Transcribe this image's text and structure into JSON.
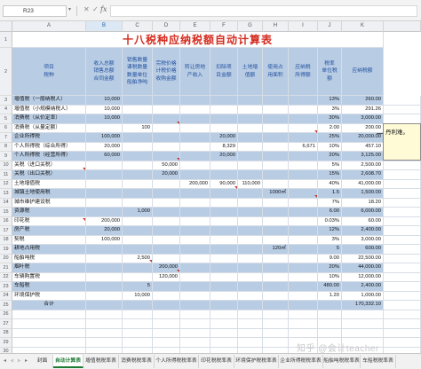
{
  "formula_bar": {
    "cell_ref": "R23",
    "fx": "fx",
    "nav_arrow": "▾",
    "cancel": "✕",
    "confirm": "✓"
  },
  "columns": [
    "A",
    "B",
    "C",
    "D",
    "E",
    "F",
    "G",
    "H",
    "I",
    "J",
    "K"
  ],
  "title": "十八税种应纳税额自动计算表",
  "headers": {
    "A": "项目\n税种",
    "B": "收入总额\n销售总额\n合同金额",
    "C": "销售数量\n课税数量\n数量单位\n船舶净吨",
    "D": "完税价格\n计税价格\n收购金额",
    "E": "转让房地\n产收入",
    "F": "扣除项\n目金额",
    "G": "土地增\n值额",
    "H": "使用占\n用面积",
    "I": "应纳税\n所得额",
    "J": "税率\n单位税额",
    "K": "应纳税额"
  },
  "rows": [
    {
      "n": "3",
      "A": "增值税（一般纳税人）",
      "B": "10,000",
      "C": "",
      "D": "",
      "E": "",
      "F": "",
      "G": "",
      "H": "",
      "I": "",
      "J": "13%",
      "K": "260.00",
      "style": "blue"
    },
    {
      "n": "4",
      "A": "增值税（小规模纳税人）",
      "B": "10,000",
      "C": "",
      "D": "",
      "E": "",
      "F": "",
      "G": "",
      "H": "",
      "I": "",
      "J": "3%",
      "K": "291.26",
      "style": "white"
    },
    {
      "n": "5",
      "A": "消费税（从价定率）",
      "B": "10,000",
      "C": "",
      "D": "",
      "E": "",
      "F": "",
      "G": "",
      "H": "",
      "I": "",
      "J": "30%",
      "K": "3,000.00",
      "style": "blue"
    },
    {
      "n": "6",
      "A": "消费税（从量定额）",
      "B": "",
      "C": "100",
      "D": "",
      "E": "",
      "F": "",
      "G": "",
      "H": "",
      "I": "",
      "J": "2.00",
      "K": "200.00",
      "style": "white"
    },
    {
      "n": "7",
      "A": "企业所得税",
      "B": "100,000",
      "C": "",
      "D": "",
      "E": "",
      "F": "20,000",
      "G": "",
      "H": "",
      "I": "",
      "J": "25%",
      "K": "20,000.00",
      "style": "blue"
    },
    {
      "n": "8",
      "A": "个人所得税（综合所得）",
      "B": "20,000",
      "C": "",
      "D": "",
      "E": "",
      "F": "8,329",
      "G": "",
      "H": "",
      "I": "6,671",
      "J": "10%",
      "K": "457.10",
      "style": "white"
    },
    {
      "n": "9",
      "A": "个人所得税（经营所得）",
      "B": "60,000",
      "C": "",
      "D": "",
      "E": "",
      "F": "20,000",
      "G": "",
      "H": "",
      "I": "",
      "J": "20%",
      "K": "3,125.00",
      "style": "blue"
    },
    {
      "n": "10",
      "A": "关税（进口关税）",
      "B": "",
      "C": "",
      "D": "50,000",
      "E": "",
      "F": "",
      "G": "",
      "H": "",
      "I": "",
      "J": "5%",
      "K": "2,500.00",
      "style": "white"
    },
    {
      "n": "11",
      "A": "关税（出口关税）",
      "B": "",
      "C": "",
      "D": "20,000",
      "E": "",
      "F": "",
      "G": "",
      "H": "",
      "I": "",
      "J": "15%",
      "K": "2,608.70",
      "style": "blue"
    },
    {
      "n": "12",
      "A": "土地增值税",
      "B": "",
      "C": "",
      "D": "",
      "E": "200,000",
      "F": "90,000",
      "G": "110,000",
      "H": "",
      "I": "",
      "J": "40%",
      "K": "41,000.00",
      "style": "white"
    },
    {
      "n": "13",
      "A": "城镇土地使用税",
      "B": "",
      "C": "",
      "D": "",
      "E": "",
      "F": "",
      "G": "",
      "H": "1000㎡",
      "I": "",
      "J": "1.5",
      "K": "1,500.00",
      "style": "blue"
    },
    {
      "n": "14",
      "A": "城市维护建设税",
      "B": "",
      "C": "",
      "D": "",
      "E": "",
      "F": "",
      "G": "",
      "H": "",
      "I": "",
      "J": "7%",
      "K": "18.20",
      "style": "white"
    },
    {
      "n": "15",
      "A": "资源税",
      "B": "",
      "C": "1,000",
      "D": "",
      "E": "",
      "F": "",
      "G": "",
      "H": "",
      "I": "",
      "J": "6.00",
      "K": "6,000.00",
      "style": "blue"
    },
    {
      "n": "16",
      "A": "印花税",
      "B": "200,000",
      "C": "",
      "D": "",
      "E": "",
      "F": "",
      "G": "",
      "H": "",
      "I": "",
      "J": "0.03%",
      "K": "60.00",
      "style": "white"
    },
    {
      "n": "17",
      "A": "房产税",
      "B": "20,000",
      "C": "",
      "D": "",
      "E": "",
      "F": "",
      "G": "",
      "H": "",
      "I": "",
      "J": "12%",
      "K": "2,400.00",
      "style": "blue"
    },
    {
      "n": "18",
      "A": "契税",
      "B": "100,000",
      "C": "",
      "D": "",
      "E": "",
      "F": "",
      "G": "",
      "H": "",
      "I": "",
      "J": "3%",
      "K": "3,000.00",
      "style": "white"
    },
    {
      "n": "19",
      "A": "耕地占用税",
      "B": "",
      "C": "",
      "D": "",
      "E": "",
      "F": "",
      "G": "",
      "H": "120㎡",
      "I": "",
      "J": "5",
      "K": "600.00",
      "style": "blue"
    },
    {
      "n": "20",
      "A": "船舶吨税",
      "B": "",
      "C": "2,500",
      "D": "",
      "E": "",
      "F": "",
      "G": "",
      "H": "",
      "I": "",
      "J": "9.00",
      "K": "22,500.00",
      "style": "white"
    },
    {
      "n": "21",
      "A": "烟叶税",
      "B": "",
      "C": "",
      "D": "200,000",
      "E": "",
      "F": "",
      "G": "",
      "H": "",
      "I": "",
      "J": "20%",
      "K": "44,000.00",
      "style": "blue"
    },
    {
      "n": "22",
      "A": "车辆购置税",
      "B": "",
      "C": "",
      "D": "120,000",
      "E": "",
      "F": "",
      "G": "",
      "H": "",
      "I": "",
      "J": "10%",
      "K": "12,000.00",
      "style": "white"
    },
    {
      "n": "23",
      "A": "车船税",
      "B": "",
      "C": "5",
      "D": "",
      "E": "",
      "F": "",
      "G": "",
      "H": "",
      "I": "",
      "J": "480.00",
      "K": "2,400.00",
      "style": "blue"
    },
    {
      "n": "24",
      "A": "环境保护税",
      "B": "",
      "C": "10,000",
      "D": "",
      "E": "",
      "F": "",
      "G": "",
      "H": "",
      "I": "",
      "J": "1.20",
      "K": "1,000.00",
      "style": "white"
    },
    {
      "n": "25",
      "A": "合计",
      "B": "",
      "C": "",
      "D": "",
      "E": "",
      "F": "",
      "G": "",
      "H": "",
      "I": "",
      "J": "",
      "K": "170,332.10",
      "style": "blue"
    }
  ],
  "empty_rows": [
    "26",
    "27",
    "28",
    "29",
    "30"
  ],
  "comment": "丹利难。",
  "watermark": "知乎 @会计teacher",
  "tabs": [
    {
      "label": "封面",
      "active": false
    },
    {
      "label": "自动计算表",
      "active": true
    },
    {
      "label": "增值税税率表",
      "active": false
    },
    {
      "label": "消费税税率表",
      "active": false
    },
    {
      "label": "个人所得税税率表",
      "active": false
    },
    {
      "label": "印花税税率表",
      "active": false
    },
    {
      "label": "环境保护税税率表",
      "active": false
    },
    {
      "label": "企业所得税税率表",
      "active": false
    },
    {
      "label": "船舶吨税税率表",
      "active": false
    },
    {
      "label": "车船税税率表",
      "active": false
    }
  ],
  "colors": {
    "header_fill": "#b8cce4",
    "title": "#d42a1e",
    "active_tab": "#1b7a33"
  }
}
